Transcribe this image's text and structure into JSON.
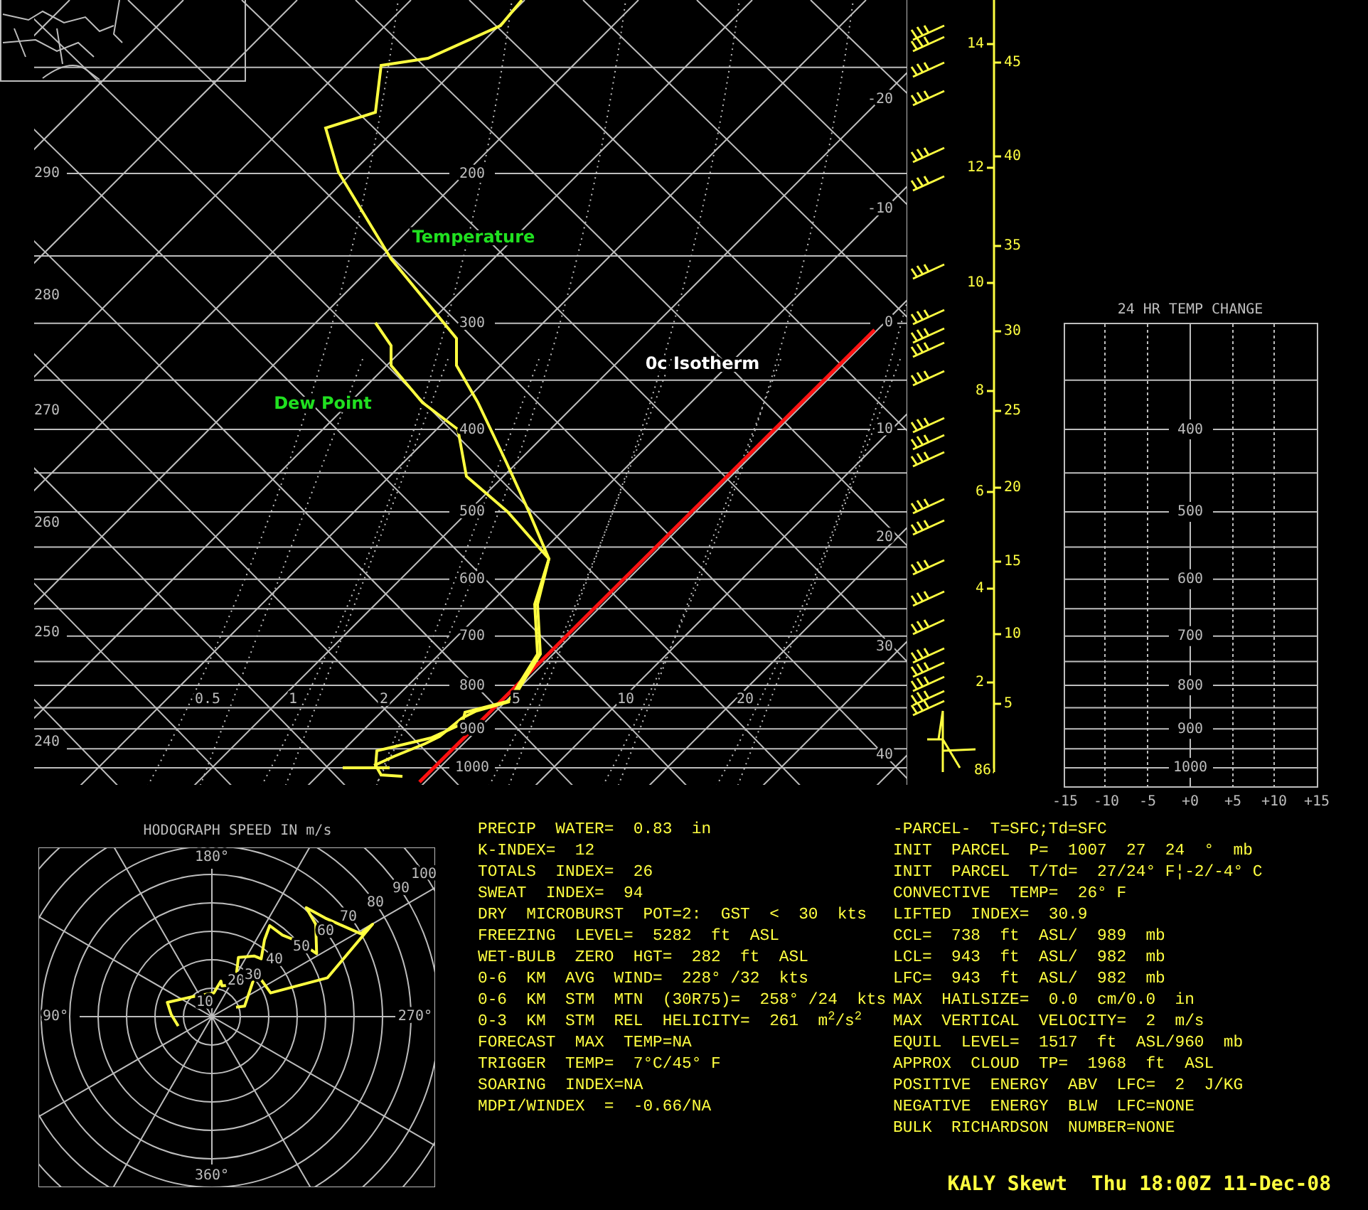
{
  "skewt": {
    "pressure_labels": [
      "200",
      "300",
      "400",
      "500",
      "600",
      "700",
      "800",
      "900",
      "1000"
    ],
    "theta_labels": [
      "290",
      "280",
      "270",
      "260",
      "250",
      "240"
    ],
    "mixing_ratio_labels": [
      "0.5",
      "1",
      "2",
      "5",
      "10",
      "20"
    ],
    "temperature_labels": [
      "-20",
      "-10",
      "0",
      "10",
      "20",
      "30",
      "40"
    ],
    "temperature_curve_label": "Temperature",
    "dewpoint_curve_label": "Dew Point",
    "isotherm_label": "0c Isotherm"
  },
  "height_axis": {
    "km_labels": [
      "14",
      "12",
      "10",
      "8",
      "6",
      "4",
      "2"
    ],
    "kft_labels": [
      "45",
      "40",
      "35",
      "30",
      "25",
      "20",
      "15",
      "10",
      "5",
      "86"
    ]
  },
  "temp_change": {
    "title": "24 HR TEMP CHANGE",
    "pressure_labels": [
      "400",
      "500",
      "600",
      "700",
      "800",
      "900",
      "1000"
    ],
    "x_labels": [
      "-15",
      "-10",
      "-5",
      "+0",
      "+5",
      "+10",
      "+15"
    ]
  },
  "hodograph": {
    "title": "HODOGRAPH SPEED IN m/s",
    "direction_labels": [
      "180°",
      "90°",
      "270°",
      "360°"
    ],
    "speed_labels": [
      "10",
      "20",
      "30",
      "40",
      "50",
      "60",
      "70",
      "80",
      "90",
      "100"
    ]
  },
  "indices_left": [
    "PRECIP  WATER=  0.83  in",
    "K-INDEX=  12",
    "TOTALS  INDEX=  26",
    "SWEAT  INDEX=  94",
    "DRY  MICROBURST  POT=2:  GST  <  30  kts",
    "FREEZING  LEVEL=  5282  ft  ASL",
    "WET-BULB  ZERO  HGT=  282  ft  ASL",
    "0-6  KM  AVG  WIND=  228° /32  kts",
    "0-6  KM  STM  MTN  (30R75)=  258° /24  kts",
    "0-3  KM  STM  REL  HELICITY=  261  m$^{2}$/s$^{2}$",
    "FORECAST  MAX  TEMP=NA",
    "TRIGGER  TEMP=  7°C/45° F",
    "SOARING  INDEX=NA",
    "MDPI/WINDEX  =  -0.66/NA"
  ],
  "indices_right": [
    "-PARCEL-  T=SFC;Td=SFC",
    "INIT  PARCEL  P=  1007  27  24  °  mb",
    "INIT  PARCEL  T/Td=  27/24° F¦-2/-4° C",
    "CONVECTIVE  TEMP=  26° F",
    "LIFTED  INDEX=  30.9",
    "CCL=  738  ft  ASL/  989  mb",
    "LCL=  943  ft  ASL/  982  mb",
    "LFC=  943  ft  ASL/  982  mb",
    "MAX  HAILSIZE=  0.0  cm/0.0  in",
    "MAX  VERTICAL  VELOCITY=  2  m/s",
    "EQUIL  LEVEL=  1517  ft  ASL/960  mb",
    "APPROX  CLOUD  TP=  1968  ft  ASL",
    "POSITIVE  ENERGY  ABV  LFC=  2  J/KG",
    "NEGATIVE  ENERGY  BLW  LFC=NONE",
    "BULK  RICHARDSON  NUMBER=NONE"
  ],
  "footer": "KALY Skewt  Thu 18:00Z 11-Dec-08"
}
